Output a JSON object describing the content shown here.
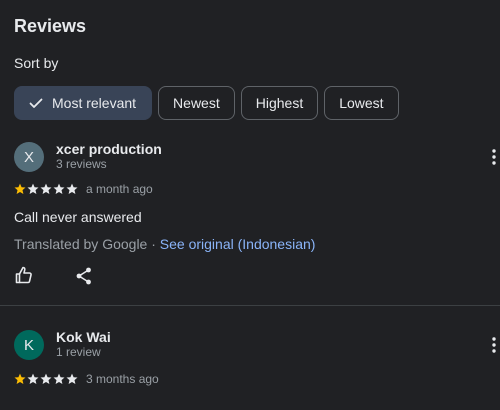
{
  "header": {
    "title": "Reviews",
    "sort_label": "Sort by"
  },
  "sort_options": [
    {
      "label": "Most relevant",
      "selected": true
    },
    {
      "label": "Newest",
      "selected": false
    },
    {
      "label": "Highest",
      "selected": false
    },
    {
      "label": "Lowest",
      "selected": false
    }
  ],
  "reviews": [
    {
      "initial": "X",
      "avatar_color": "#546e7a",
      "name": "xcer production",
      "review_count": "3 reviews",
      "rating": 1,
      "max_rating": 5,
      "time": "a month ago",
      "text": "Call never answered",
      "translated_by": "Translated by Google · ",
      "see_original": "See original (Indonesian)"
    },
    {
      "initial": "K",
      "avatar_color": "#00695c",
      "name": "Kok Wai",
      "review_count": "1 review",
      "rating": 1,
      "max_rating": 5,
      "time": "3 months ago"
    }
  ],
  "colors": {
    "background": "#202124",
    "selected_chip": "#394457",
    "star_filled": "#fbbc04",
    "star_empty": "#e8eaed",
    "link": "#8ab4f8"
  },
  "icons": {
    "check": "check-icon",
    "more": "more-vert-icon",
    "like": "thumb-up-icon",
    "share": "share-icon"
  }
}
